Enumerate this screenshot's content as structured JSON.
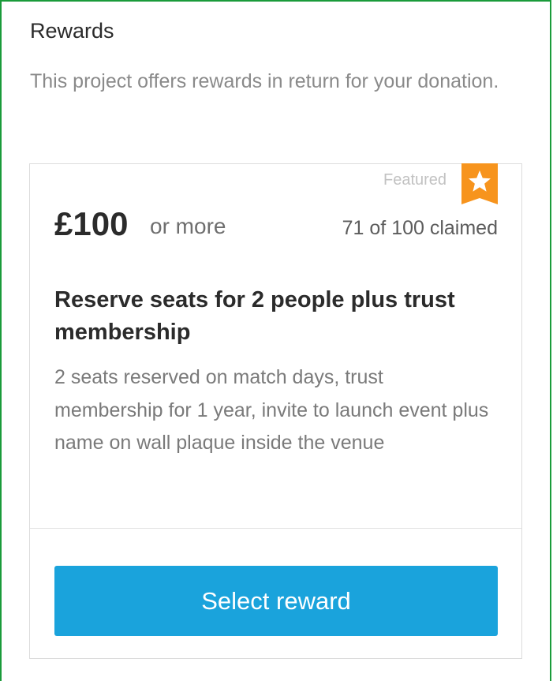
{
  "rewards_section": {
    "title": "Rewards",
    "description": "This project offers rewards in return for your donation."
  },
  "reward": {
    "featured_label": "Featured",
    "featured_icon": "star-icon",
    "price": "£100",
    "price_suffix": "or more",
    "claimed_text": "71 of 100 claimed",
    "claimed_count": 71,
    "claimed_total": 100,
    "title": "Reserve seats for 2 people plus trust membership",
    "description": "2 seats reserved on match days, trust membership for 1 year, invite to launch event plus name on wall plaque inside the venue",
    "select_button_label": "Select reward"
  },
  "colors": {
    "accent": "#1aa3dc",
    "featured": "#f7941d",
    "frame": "#1a9b3a"
  }
}
